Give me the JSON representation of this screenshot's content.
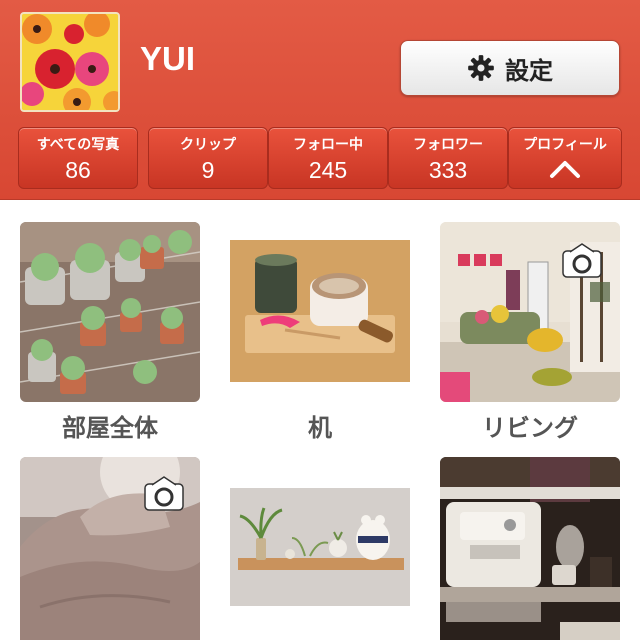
{
  "header": {
    "username": "YUI",
    "settings_label": "設定",
    "settings_icon": "gear-icon",
    "background_color": "#dc4d39"
  },
  "stats": [
    {
      "label": "すべての写真",
      "value": "86"
    },
    {
      "label": "クリップ",
      "value": "9"
    },
    {
      "label": "フォロー中",
      "value": "245"
    },
    {
      "label": "フォロワー",
      "value": "333"
    },
    {
      "label": "プロフィール",
      "icon": "chevron-up-icon"
    }
  ],
  "albums": [
    {
      "caption": "部屋全体",
      "has_camera_icon": false
    },
    {
      "caption": "机",
      "has_camera_icon": false
    },
    {
      "caption": "リビング",
      "has_camera_icon": true
    },
    {
      "caption": "",
      "has_camera_icon": true
    },
    {
      "caption": "",
      "has_camera_icon": false
    },
    {
      "caption": "",
      "has_camera_icon": false
    }
  ]
}
